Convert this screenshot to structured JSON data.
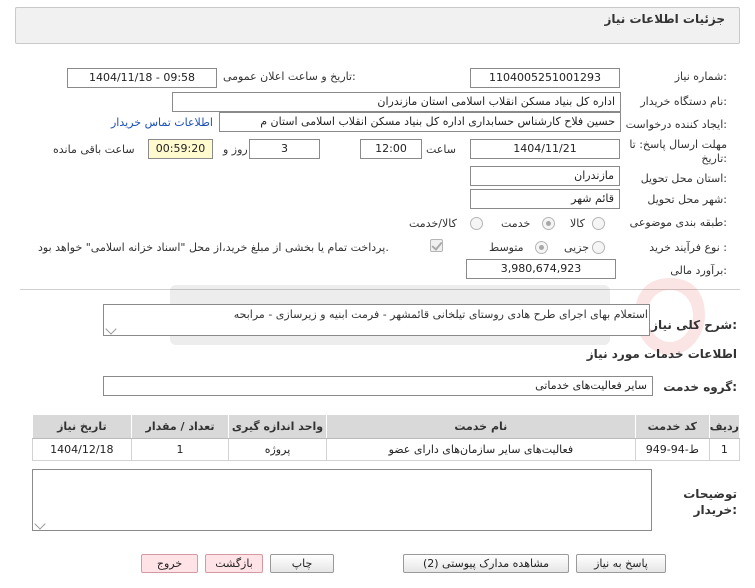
{
  "header": {
    "title": "جزئیات اطلاعات نیاز"
  },
  "form": {
    "need_number_label": "شماره نیاز:",
    "need_number": "1104005251001293",
    "announce_label": "تاریخ و ساعت اعلان عمومی:",
    "announce_value": "1404/11/18 - 09:58",
    "buyer_org_label": "نام دستگاه خریدار:",
    "buyer_org": "اداره کل بنیاد مسکن انقلاب اسلامی استان مازندران",
    "creator_label": "ایجاد کننده درخواست:",
    "creator": "حسین فلاح کارشناس حسابداری اداره کل بنیاد مسکن انقلاب اسلامی استان م",
    "contact_link": "اطلاعات تماس خریدار",
    "deadline_label_1": "مهلت ارسال پاسخ: تا",
    "deadline_label_2": "تاریخ:",
    "deadline_date": "1404/11/21",
    "time_label": "ساعت",
    "deadline_time": "12:00",
    "days_value": "3",
    "days_label": "روز و",
    "remaining_time": "00:59:20",
    "remaining_label": "ساعت باقی مانده",
    "province_label": "استان محل تحویل:",
    "province": "مازندران",
    "city_label": "شهر محل تحویل:",
    "city": "قائم شهر",
    "category_label": "طبقه بندی موضوعی:",
    "category_options": [
      "کالا",
      "خدمت",
      "کالا/خدمت"
    ],
    "category_selected": "خدمت",
    "process_label": "نوع فرآیند خرید :",
    "process_options": [
      "جزیی",
      "متوسط"
    ],
    "process_selected": "متوسط",
    "payment_note": "پرداخت تمام یا بخشی از مبلغ خرید،از محل \"اسناد خزانه اسلامی\" خواهد بود.",
    "estimate_label": "برآورد مالی:",
    "estimate": "3,980,674,923"
  },
  "summary": {
    "label": "شرح کلی نیاز:",
    "text": "استعلام بهای اجرای طرح هادی روستای  تیلخانی  قائمشهر   - فرمت ابنیه و زیرسازی - مرابحه"
  },
  "services": {
    "section_title": "اطلاعات خدمات مورد نیاز",
    "group_label": "گروه خدمت:",
    "group_value": "سایر فعالیت‌های خدماتی",
    "columns": [
      "ردیف",
      "کد خدمت",
      "نام خدمت",
      "واحد اندازه گیری",
      "تعداد / مقدار",
      "تاریخ نیاز"
    ],
    "rows": [
      {
        "row": "1",
        "code": "ط-94-949",
        "name": "فعالیت‌های سایر سازمان‌های دارای عضو",
        "unit": "پروژه",
        "qty": "1",
        "date": "1404/12/18"
      }
    ]
  },
  "buyer_notes": {
    "label_1": "توضیحات",
    "label_2": "خریدار:"
  },
  "buttons": {
    "reply": "پاسخ به نیاز",
    "attachments": "مشاهده مدارک پیوستی (2)",
    "print": "چاپ",
    "back": "بازگشت",
    "exit": "خروج"
  },
  "colors": {
    "accent_link": "#1a4fb8",
    "yellow_field": "#fffbcf",
    "pink_button": "#ffe3e7",
    "header_bg": "#f1f1f1"
  }
}
